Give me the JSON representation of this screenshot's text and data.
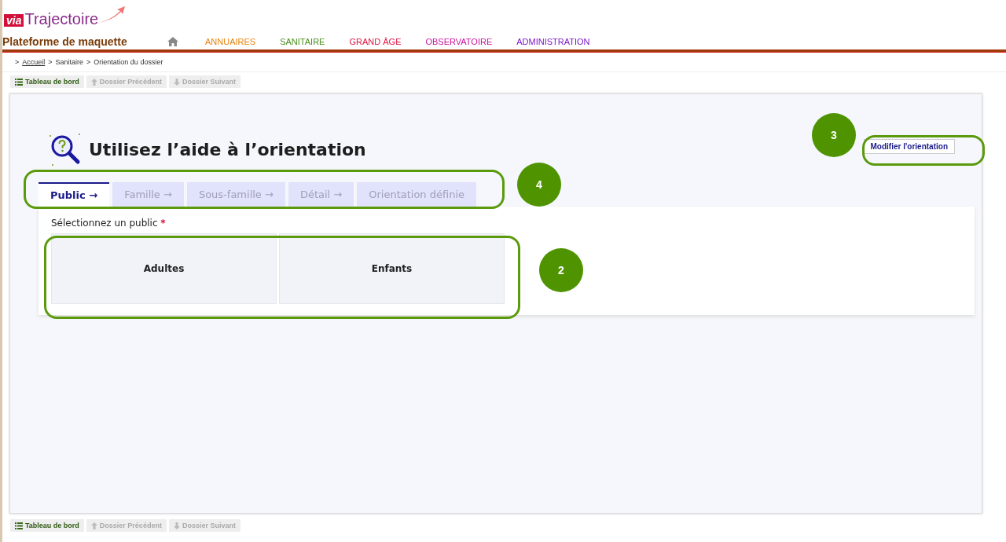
{
  "header": {
    "logo_prefix": "via",
    "logo_name": "Trajectoire",
    "platform": "Plateforme de maquette"
  },
  "nav": [
    {
      "label": "ANNUAIRES",
      "color": "#e8830c"
    },
    {
      "label": "SANITAIRE",
      "color": "#4a8f1c"
    },
    {
      "label": "GRAND ÂGE",
      "color": "#e0123f"
    },
    {
      "label": "OBSERVATOIRE",
      "color": "#c8169a"
    },
    {
      "label": "ADMINISTRATION",
      "color": "#7a17c8"
    }
  ],
  "breadcrumb": [
    {
      "separator": ">",
      "label": "Accueil",
      "link": true
    },
    {
      "separator": ">",
      "label": "Sanitaire",
      "link": false
    },
    {
      "separator": ">",
      "label": "Orientation du dossier",
      "link": false
    }
  ],
  "toolbar": [
    {
      "label": "Tableau de bord",
      "disabled": false
    },
    {
      "label": "Dossier Précédent",
      "disabled": true
    },
    {
      "label": "Dossier Suivant",
      "disabled": true
    }
  ],
  "page_title": "Utilisez l’aide à l’orientation",
  "modify_button": "Modifier l'orientation",
  "tabs": [
    {
      "label": "Public →",
      "selected": true
    },
    {
      "label": "Famille →",
      "selected": false
    },
    {
      "label": "Sous-famille →",
      "selected": false
    },
    {
      "label": "Détail →",
      "selected": false
    },
    {
      "label": "Orientation définie",
      "selected": false
    }
  ],
  "field_label": "Sélectionnez un public",
  "required_mark": "*",
  "options": [
    "Adultes",
    "Enfants"
  ],
  "callouts": [
    "3",
    "4",
    "2"
  ],
  "bottom_toolbar": [
    {
      "label": "Tableau de bord",
      "disabled": false
    },
    {
      "label": "Dossier Précédent",
      "disabled": true
    },
    {
      "label": "Dossier Suivant",
      "disabled": true
    }
  ]
}
